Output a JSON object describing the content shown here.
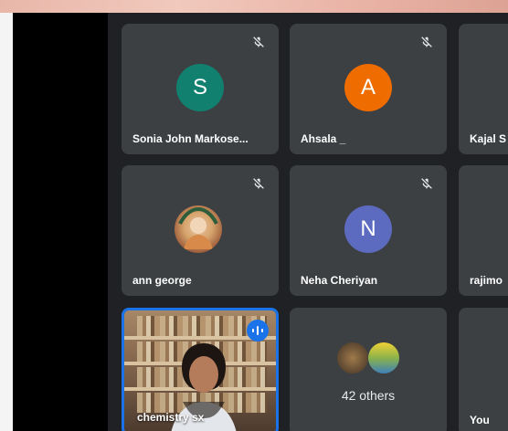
{
  "participants": {
    "sonia": {
      "name": "Sonia John Markose...",
      "initial": "S"
    },
    "ahsala": {
      "name": "Ahsala _",
      "initial": "A"
    },
    "kajal": {
      "name": "Kajal S"
    },
    "ann": {
      "name": "ann george"
    },
    "neha": {
      "name": "Neha Cheriyan",
      "initial": "N"
    },
    "raji": {
      "name": "rajimo"
    },
    "chemistry": {
      "name": "chemistry sx"
    },
    "others": {
      "label": "42 others"
    },
    "you": {
      "name": "You"
    }
  },
  "colors": {
    "tile": "#3c4043",
    "sonia_avatar": "#12806f",
    "ahsala_avatar": "#ef6c00",
    "neha_avatar": "#5c6bc0",
    "speaking_border": "#1a73e8"
  },
  "icons": {
    "mute": "microphone-off-icon",
    "speaking": "audio-level-icon"
  }
}
